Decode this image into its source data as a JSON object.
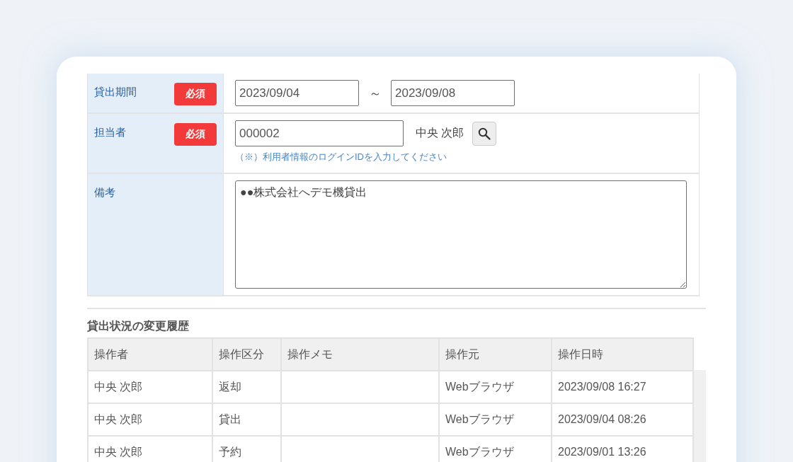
{
  "form": {
    "rows": [
      {
        "kind": "date_range",
        "label": "貸出期間",
        "required_label": "必須",
        "start": "2023/09/04",
        "separator": "～",
        "end": "2023/09/08"
      },
      {
        "kind": "user",
        "label": "担当者",
        "required_label": "必須",
        "value": "000002",
        "name": "中央 次郎",
        "hint": "（※）利用者情報のログインIDを入力してください"
      },
      {
        "kind": "textarea",
        "label": "備考",
        "value": "●●株式会社へデモ機貸出"
      }
    ]
  },
  "history": {
    "title": "貸出状況の変更履歴",
    "columns": [
      "操作者",
      "操作区分",
      "操作メモ",
      "操作元",
      "操作日時"
    ],
    "rows": [
      [
        "中央 次郎",
        "返却",
        "",
        "Webブラウザ",
        "2023/09/08 16:27"
      ],
      [
        "中央 次郎",
        "貸出",
        "",
        "Webブラウザ",
        "2023/09/04 08:26"
      ],
      [
        "中央 次郎",
        "予約",
        "",
        "Webブラウザ",
        "2023/09/01 13:26"
      ]
    ]
  }
}
